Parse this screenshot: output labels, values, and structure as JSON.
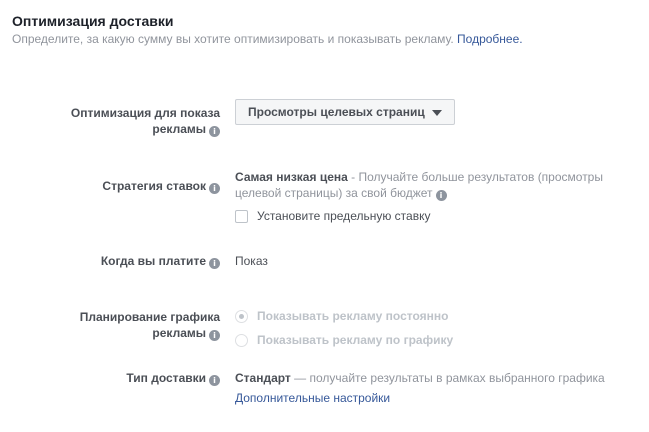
{
  "section": {
    "title": "Оптимизация доставки",
    "description": "Определите, за какую сумму вы хотите оптимизировать и показывать рекламу.",
    "learn_more": "Подробнее."
  },
  "optimization": {
    "label_line1": "Оптимизация для показа",
    "label_line2": "рекламы",
    "selected": "Просмотры целевых страниц"
  },
  "bid_strategy": {
    "label": "Стратегия ставок",
    "value_bold": "Самая низкая цена",
    "value_desc": " - Получайте больше результатов (просмотры",
    "value_desc2": "целевой страницы) за свой бюджет",
    "checkbox_label": "Установите предельную ставку"
  },
  "when_you_pay": {
    "label": "Когда вы платите",
    "value": "Показ"
  },
  "scheduling": {
    "label_line1": "Планирование графика",
    "label_line2": "рекламы",
    "option1": "Показывать рекламу постоянно",
    "option2": "Показывать рекламу по графику"
  },
  "delivery_type": {
    "label": "Тип доставки",
    "value_bold": "Стандарт",
    "value_desc": " — получайте результаты в рамках выбранного графика",
    "more_settings": "Дополнительные настройки"
  },
  "icons": {
    "info": "info-icon",
    "caret": "caret-down-icon"
  },
  "colors": {
    "link": "#365899",
    "muted": "#90949c",
    "text": "#1d2129"
  }
}
